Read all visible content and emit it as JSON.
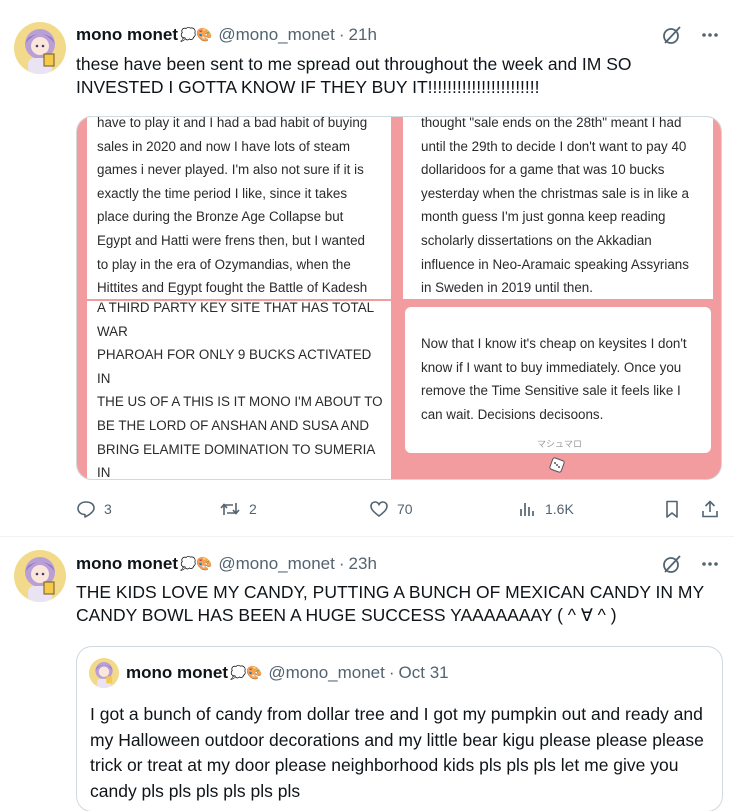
{
  "tweets": [
    {
      "name": "mono monet",
      "emojis": "💭🎨",
      "handle": "@mono_monet",
      "time": "21h",
      "text": "these have been sent to me spread out throughout the week and IM SO INVESTED I GOTTA KNOW IF THEY BUY IT!!!!!!!!!!!!!!!!!!!!!!!",
      "media": {
        "panel_top_left": "have to play it and I had a bad habit of buying\nsales in 2020 and now I have lots of steam\ngames i never played. I'm also not sure if it is\nexactly the time period I like, since it takes\nplace during the Bronze Age Collapse but\nEgypt and Hatti were frens then, but I wanted\nto play in the era of Ozymandias, when the\nHittites and Egypt fought the Battle of Kadesh",
        "panel_bottom_left": "A THIRD PARTY KEY SITE THAT HAS TOTAL WAR\nPHAROAH FOR ONLY 9 BUCKS ACTIVATED IN\nTHE US OF A THIS IS IT MONO I'M ABOUT TO\nBE THE LORD OF ANSHAN AND SUSA AND\nBRING ELAMITE DOMINATION TO SUMERIA IN\nREVENGE FOR ALL THOSE TIMES THEY\nINVADED FOR NO REASON OTHER THAN TO\nDUNK ON ELAM",
        "panel_top_right": "thought \"sale ends on the 28th\" meant I had\nuntil the 29th to decide I don't want to pay 40\ndollaridoos for a game that was 10 bucks\nyesterday when the christmas sale is in like a\nmonth guess I'm just gonna keep reading\nscholarly dissertations on the Akkadian\ninfluence in Neo-Aramaic speaking Assyrians\nin Sweden in 2019 until then.",
        "panel_bottom_right": "Now that I know it's cheap on keysites I don't\nknow if I want to buy immediately. Once you\nremove the Time Sensitive sale it feels like I\ncan wait. Decisions decisoons.",
        "watermark": "マシュマロ"
      },
      "stats": {
        "replies": "3",
        "reposts": "2",
        "likes": "70",
        "views": "1.6K"
      }
    },
    {
      "name": "mono monet",
      "emojis": "💭🎨",
      "handle": "@mono_monet",
      "time": "23h",
      "text": "THE KIDS LOVE MY CANDY, PUTTING A BUNCH OF MEXICAN CANDY IN MY CANDY BOWL HAS BEEN A HUGE SUCCESS YAAAAAAAY ( ^ ∀ ^ )",
      "quote": {
        "name": "mono monet",
        "emojis": "💭🎨",
        "handle": "@mono_monet",
        "time": "Oct 31",
        "text": "I got a bunch of candy from dollar tree and I got my pumpkin out and ready and my Halloween outdoor decorations and my little bear kigu please please please trick or treat at my door please neighborhood kids pls pls pls let me give you candy pls pls pls pls pls pls"
      }
    }
  ],
  "dot": "·",
  "icons": [
    "grok-slash-icon",
    "more-icon",
    "reply-icon",
    "repost-icon",
    "like-icon",
    "views-icon",
    "bookmark-icon",
    "share-icon",
    "dice-icon"
  ],
  "colors": {
    "text": "#0f1419",
    "muted": "#536471",
    "border": "#cfd9de",
    "media_pink": "#f29ca0"
  }
}
